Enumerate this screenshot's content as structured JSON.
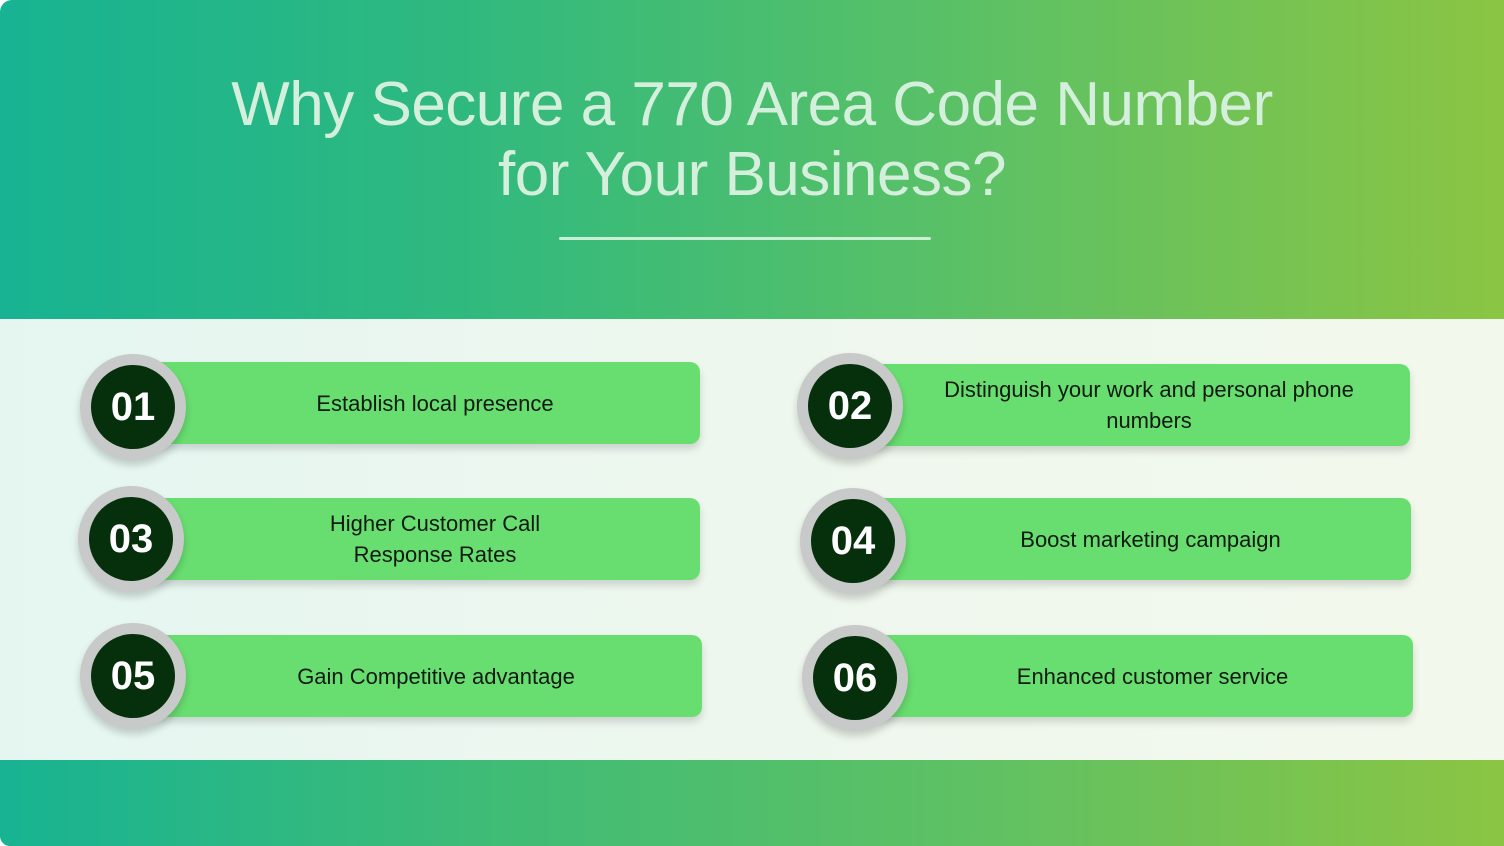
{
  "header": {
    "title_line1": "Why Secure a 770 Area Code Number",
    "title_line2": "for Your Business?"
  },
  "colors": {
    "gradient_start": "#17b392",
    "gradient_end": "#8bc543",
    "card_green": "#68de70",
    "badge_dark": "#06300c",
    "badge_ring": "#c8c9c9",
    "title_text": "#d4f0dc"
  },
  "items": [
    {
      "number": "01",
      "text": "Establish local presence"
    },
    {
      "number": "02",
      "text": "Distinguish your work and personal phone numbers"
    },
    {
      "number": "03",
      "text": "Higher Customer Call Response Rates"
    },
    {
      "number": "04",
      "text": "Boost marketing campaign"
    },
    {
      "number": "05",
      "text": "Gain Competitive advantage"
    },
    {
      "number": "06",
      "text": "Enhanced customer service"
    }
  ]
}
